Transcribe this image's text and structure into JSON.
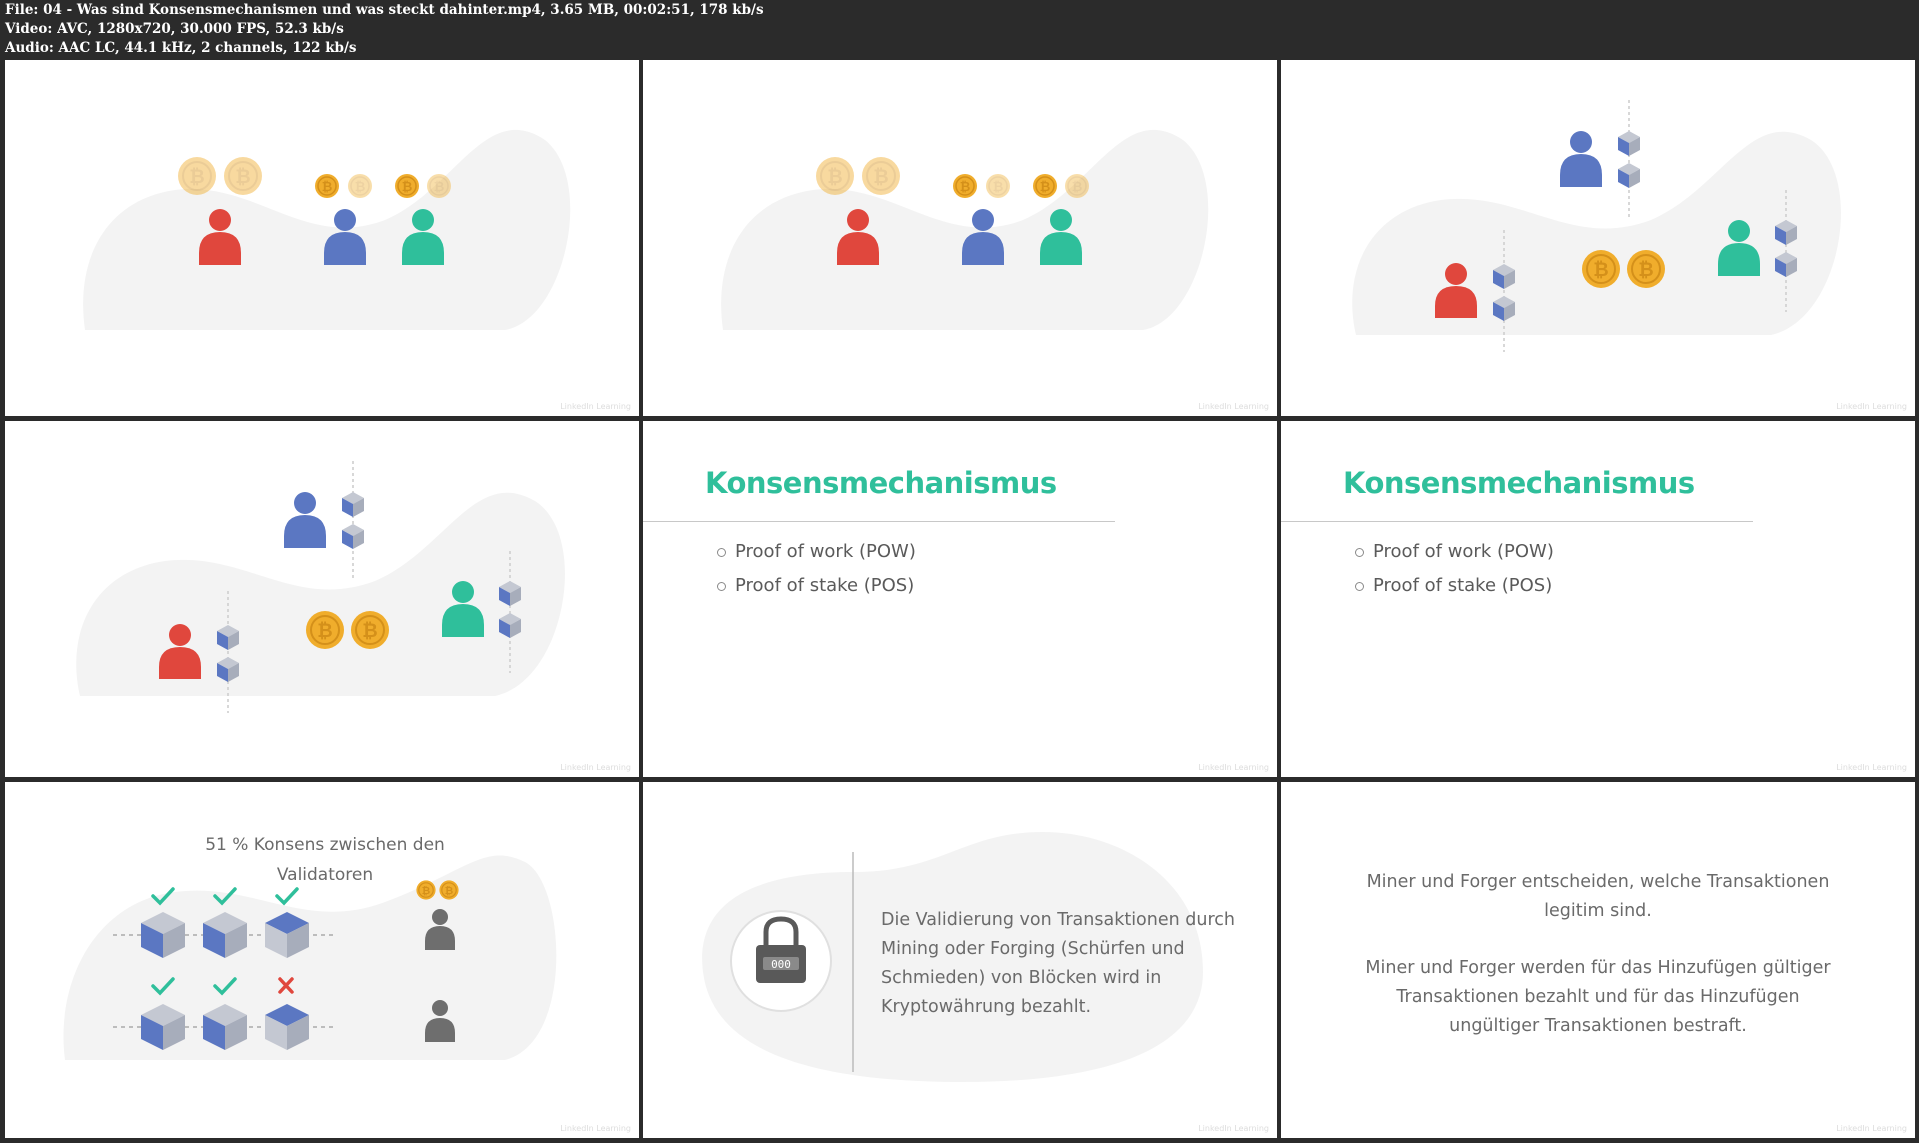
{
  "file_info": {
    "file_line": "File: 04 - Was sind Konsensmechanismen und was steckt dahinter.mp4, 3.65 MB, 00:02:51, 178 kb/s",
    "video_line": "Video: AVC, 1280x720, 30.000 FPS, 52.3 kb/s",
    "audio_line": "Audio: AAC LC, 44.1 kHz, 2 channels, 122 kb/s"
  },
  "watermark": "LinkedIn Learning",
  "slides": {
    "slide5": {
      "title": "Konsensmechanismus",
      "bullets": [
        "Proof of work (POW)",
        "Proof of stake (POS)"
      ]
    },
    "slide6": {
      "title": "Konsensmechanismus",
      "bullets": [
        "Proof of work (POW)",
        "Proof of stake (POS)"
      ]
    },
    "slide7": {
      "caption_line1": "51 % Konsens zwischen den",
      "caption_line2": "Validatoren"
    },
    "slide8": {
      "text_lines": [
        "Die Validierung von Transaktionen durch",
        "Mining oder Forging (Schürfen und",
        "Schmieden) von Blöcken wird in",
        "Kryptowährung bezahlt."
      ],
      "lock_digits": "000"
    },
    "slide9": {
      "para1_lines": [
        "Miner und Forger entscheiden, welche Transaktionen",
        "legitim sind."
      ],
      "para2_lines": [
        "Miner und Forger werden für das Hinzufügen gültiger",
        "Transaktionen bezahlt und für das Hinzufügen",
        "ungültiger Transaktionen bestraft."
      ]
    }
  },
  "colors": {
    "accent_green": "#2fbf9b",
    "person_red": "#e0473d",
    "person_blue": "#5b77c2",
    "person_green": "#2fbf9b",
    "coin_gold": "#f0ad2c",
    "check_green": "#2fbf9b",
    "cross_red": "#e0473d"
  }
}
